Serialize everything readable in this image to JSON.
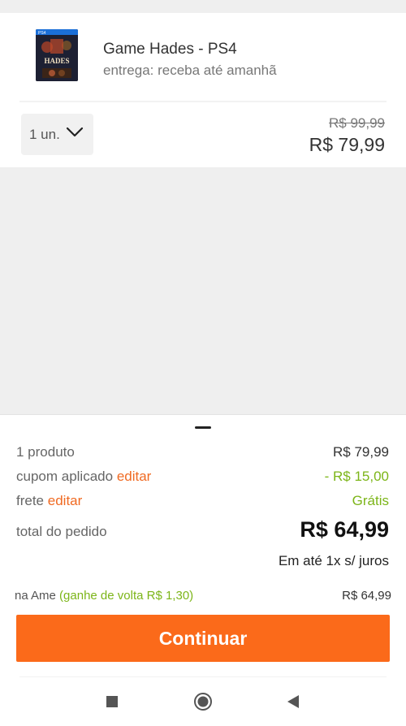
{
  "cart_item": {
    "title": "Game Hades - PS4",
    "delivery": "entrega: receba até amanhã",
    "quantity": "1 un.",
    "old_price": "R$ 99,99",
    "price": "R$ 79,99",
    "thumb_logo": "HADES",
    "thumb_badge": "PS4"
  },
  "summary": {
    "products_label": "1 produto",
    "products_value": "R$ 79,99",
    "coupon_label": "cupom aplicado",
    "coupon_edit": "editar",
    "coupon_value": "- R$ 15,00",
    "shipping_label": "frete",
    "shipping_edit": "editar",
    "shipping_value": "Grátis",
    "total_label": "total do pedido",
    "total_value": "R$ 64,99",
    "installments": "Em até 1x s/ juros",
    "ame_label": "na Ame",
    "ame_cashback": "(ganhe de volta R$ 1,30)",
    "ame_value": "R$ 64,99",
    "continue_label": "Continuar"
  },
  "colors": {
    "accent_orange": "#fb6a1a",
    "link_orange": "#f06a22",
    "discount_green": "#7cb518"
  },
  "icons": {
    "qty": "chevron-down-icon",
    "nav_recent": "square-icon",
    "nav_home": "circle-icon",
    "nav_back": "triangle-back-icon"
  }
}
